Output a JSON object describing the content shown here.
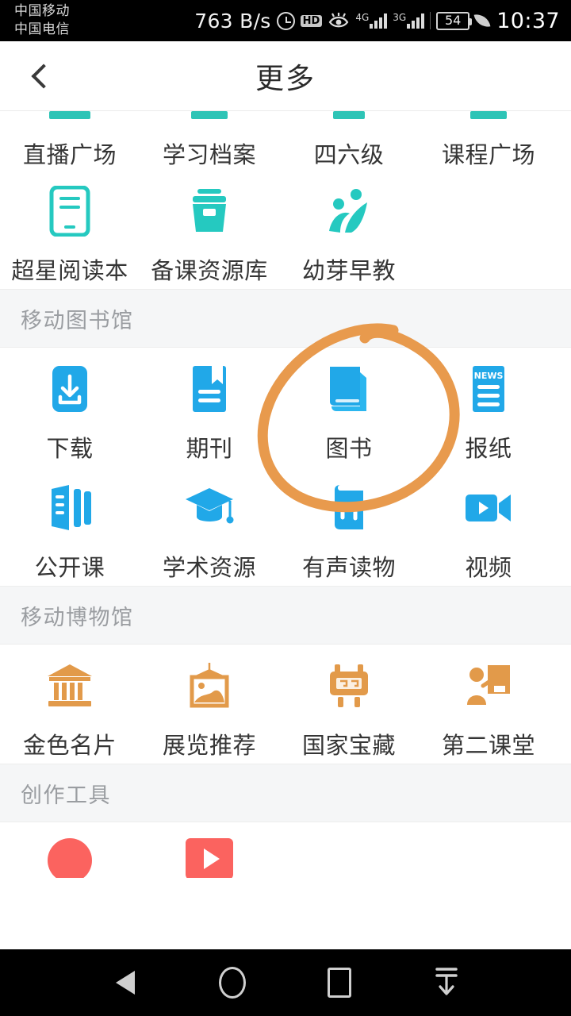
{
  "status_bar": {
    "carrier_line1": "中国移动",
    "carrier_line2": "中国电信",
    "net_speed": "763 B/s",
    "alarm_icon": "alarm-icon",
    "hd_label": "HD",
    "eye_icon": "eye-comfort-icon",
    "sim1_network": "4G",
    "sim2_network": "3G",
    "battery_percent": "54",
    "power_save_icon": "leaf-icon",
    "clock": "10:37"
  },
  "app_bar": {
    "back_icon": "chevron-left-icon",
    "title": "更多"
  },
  "top_partial_row": {
    "items": [
      {
        "label": "直播广场",
        "icon": "live-square-icon"
      },
      {
        "label": "学习档案",
        "icon": "study-archive-icon"
      },
      {
        "label": "四六级",
        "icon": "cet-exam-icon"
      },
      {
        "label": "课程广场",
        "icon": "course-square-icon"
      }
    ]
  },
  "tools_row": {
    "items": [
      {
        "label": "超星阅读本",
        "icon": "reader-tablet-icon"
      },
      {
        "label": "备课资源库",
        "icon": "lesson-resource-box-icon"
      },
      {
        "label": "幼芽早教",
        "icon": "early-education-icon"
      }
    ]
  },
  "sections": [
    {
      "title": "移动图书馆",
      "name": "mobile-library",
      "accent": "#21a8e8",
      "items": [
        {
          "label": "下载",
          "icon": "download-icon"
        },
        {
          "label": "期刊",
          "icon": "journal-icon"
        },
        {
          "label": "图书",
          "icon": "book-icon",
          "annotated": true
        },
        {
          "label": "报纸",
          "icon": "newspaper-icon",
          "badge": "NEWS"
        },
        {
          "label": "公开课",
          "icon": "open-course-icon"
        },
        {
          "label": "学术资源",
          "icon": "graduation-cap-icon"
        },
        {
          "label": "有声读物",
          "icon": "audiobook-icon"
        },
        {
          "label": "视频",
          "icon": "video-camera-icon"
        }
      ]
    },
    {
      "title": "移动博物馆",
      "name": "mobile-museum",
      "accent": "#e29a4a",
      "items": [
        {
          "label": "金色名片",
          "icon": "museum-building-icon"
        },
        {
          "label": "展览推荐",
          "icon": "picture-frame-icon"
        },
        {
          "label": "国家宝藏",
          "icon": "bronze-treasure-icon"
        },
        {
          "label": "第二课堂",
          "icon": "classroom-icon"
        }
      ]
    },
    {
      "title": "创作工具",
      "name": "creation-tools",
      "accent": "#fb635f",
      "items": [
        {
          "label": "",
          "icon": "record-circle-icon"
        },
        {
          "label": "",
          "icon": "video-play-icon"
        }
      ]
    }
  ],
  "annotation": {
    "shape": "hand-drawn-circle",
    "color": "#e89a4d",
    "targets_label": "图书"
  },
  "nav_bar": {
    "back": "back-triangle-icon",
    "home": "home-circle-icon",
    "recents": "recents-square-icon",
    "hide_navbar": "hide-navbar-icon"
  }
}
